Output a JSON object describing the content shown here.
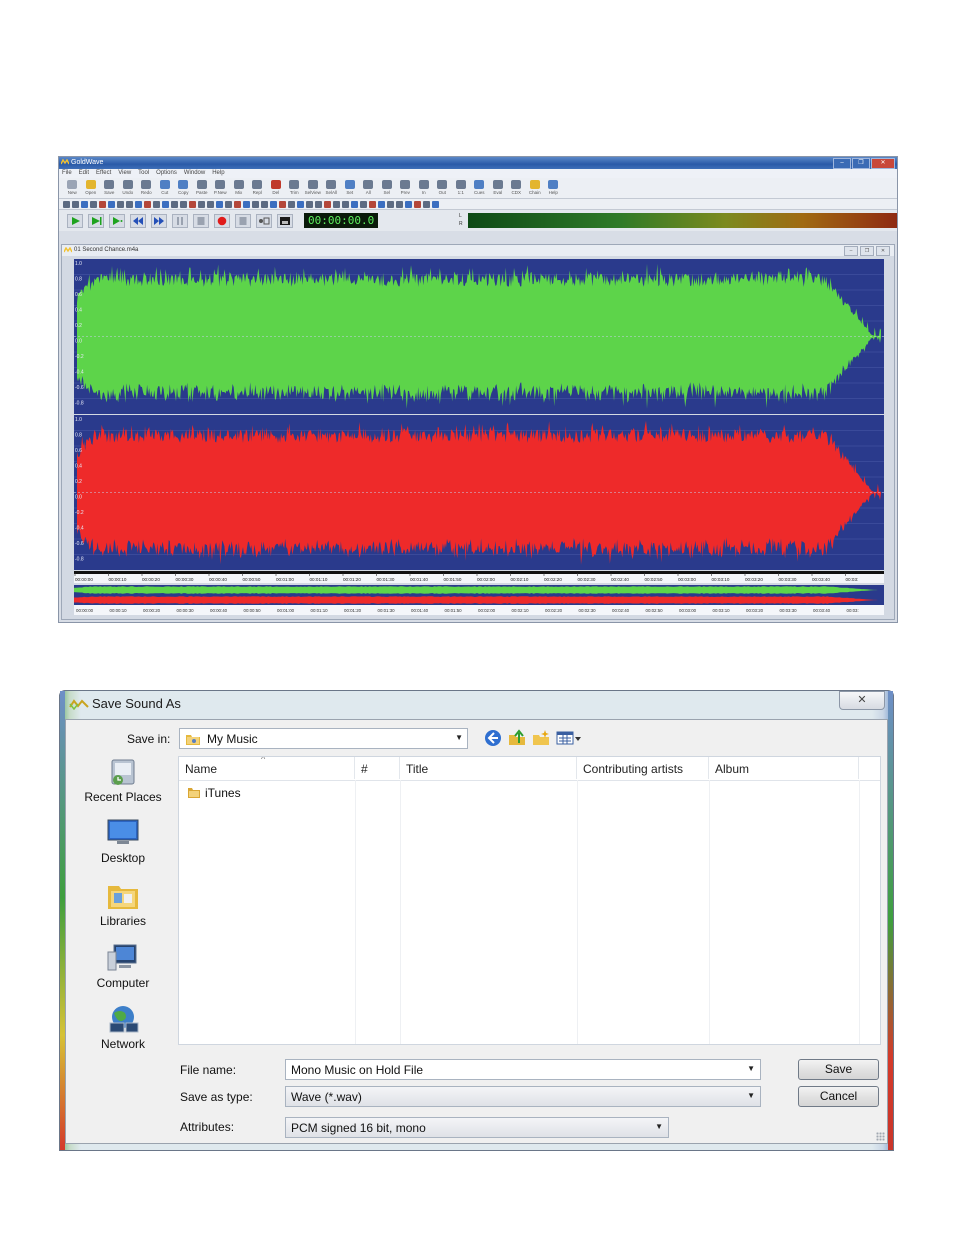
{
  "goldwave": {
    "title": "GoldWave",
    "window_buttons": [
      "–",
      "❐",
      "✕"
    ],
    "menu": [
      "File",
      "Edit",
      "Effect",
      "View",
      "Tool",
      "Options",
      "Window",
      "Help"
    ],
    "toolbar1": [
      {
        "label": "New",
        "icon": "new-file-icon",
        "tone": "p"
      },
      {
        "label": "Open",
        "icon": "open-folder-icon",
        "tone": "y"
      },
      {
        "label": "Save",
        "icon": "save-icon",
        "tone": "g"
      },
      {
        "label": "Undo",
        "icon": "undo-icon",
        "tone": "g"
      },
      {
        "label": "Redo",
        "icon": "redo-icon",
        "tone": "g"
      },
      {
        "label": "Cut",
        "icon": "cut-icon",
        "tone": "a"
      },
      {
        "label": "Copy",
        "icon": "copy-icon",
        "tone": "a"
      },
      {
        "label": "Paste",
        "icon": "paste-icon",
        "tone": "g"
      },
      {
        "label": "P.New",
        "icon": "paste-new-icon",
        "tone": "g"
      },
      {
        "label": "Mix",
        "icon": "mix-icon",
        "tone": "g"
      },
      {
        "label": "Repl",
        "icon": "replace-icon",
        "tone": "g"
      },
      {
        "label": "Del",
        "icon": "delete-icon",
        "tone": "r"
      },
      {
        "label": "Trim",
        "icon": "trim-icon",
        "tone": "g"
      },
      {
        "label": "SelView",
        "icon": "select-view-icon",
        "tone": "g"
      },
      {
        "label": "SelAll",
        "icon": "select-all-icon",
        "tone": "g"
      },
      {
        "label": "Set",
        "icon": "set-icon",
        "tone": "a"
      },
      {
        "label": "All",
        "icon": "zoom-all-icon",
        "tone": "g"
      },
      {
        "label": "Sel",
        "icon": "zoom-selection-icon",
        "tone": "g"
      },
      {
        "label": "Prev",
        "icon": "zoom-previous-icon",
        "tone": "g"
      },
      {
        "label": "In",
        "icon": "zoom-in-icon",
        "tone": "g"
      },
      {
        "label": "Out",
        "icon": "zoom-out-icon",
        "tone": "g"
      },
      {
        "label": "1:1",
        "icon": "zoom-one-icon",
        "tone": "g"
      },
      {
        "label": "Cues",
        "icon": "cues-icon",
        "tone": "a"
      },
      {
        "label": "Eval",
        "icon": "expression-evaluator-icon",
        "tone": "g"
      },
      {
        "label": "CDX",
        "icon": "cd-extract-icon",
        "tone": "g"
      },
      {
        "label": "Chain",
        "icon": "chain-icon",
        "tone": "y"
      },
      {
        "label": "Help",
        "icon": "help-icon",
        "tone": "a"
      }
    ],
    "time": "00:00:00.0",
    "meter_labels": [
      "L",
      "R"
    ],
    "document": {
      "title": "01 Second Chance.m4a",
      "buttons": [
        "–",
        "❐",
        "✕"
      ],
      "amplitude_labels": [
        "1.0",
        "0.8",
        "0.6",
        "0.4",
        "0.2",
        "0.0",
        "-0.2",
        "-0.4",
        "-0.6",
        "-0.8"
      ],
      "timeline": [
        "00:00:00",
        "00:00:10",
        "00:00:20",
        "00:00:30",
        "00:00:40",
        "00:00:50",
        "00:01:00",
        "00:01:10",
        "00:01:20",
        "00:01:30",
        "00:01:40",
        "00:01:50",
        "00:02:00",
        "00:02:10",
        "00:02:20",
        "00:02:30",
        "00:02:40",
        "00:02:50",
        "00:03:00",
        "00:03:10",
        "00:03:20",
        "00:03:30",
        "00:03:40",
        "00:03:"
      ],
      "overview_timeline": [
        "00:00:00",
        "00:00:10",
        "00:00:20",
        "00:00:30",
        "00:00:40",
        "00:00:50",
        "00:01:00",
        "00:01:10",
        "00:01:20",
        "00:01:30",
        "00:01:40",
        "00:01:50",
        "00:02:00",
        "00:02:10",
        "00:02:20",
        "00:02:30",
        "00:02:40",
        "00:02:50",
        "00:03:00",
        "00:03:10",
        "00:03:20",
        "00:03:30",
        "00:03:40",
        "00:03:"
      ]
    },
    "colors": {
      "left_channel": "#5dd44a",
      "right_channel": "#ee2a2a",
      "background": "#2a3a8c"
    }
  },
  "dialog": {
    "title": "Save Sound As",
    "close": "✕",
    "save_in_label": "Save in:",
    "save_in_value": "My Music",
    "columns": [
      "Name",
      "#",
      "Title",
      "Contributing artists",
      "Album"
    ],
    "files": [
      {
        "name": "iTunes",
        "icon": "folder-icon"
      }
    ],
    "places": [
      {
        "label": "Recent Places",
        "icon": "recent-places-icon"
      },
      {
        "label": "Desktop",
        "icon": "desktop-icon"
      },
      {
        "label": "Libraries",
        "icon": "libraries-icon"
      },
      {
        "label": "Computer",
        "icon": "computer-icon"
      },
      {
        "label": "Network",
        "icon": "network-icon"
      }
    ],
    "file_name_label": "File name:",
    "file_name_value": "Mono Music on Hold File",
    "save_type_label": "Save as type:",
    "save_type_value": "Wave (*.wav)",
    "attributes_label": "Attributes:",
    "attributes_value": "PCM signed 16 bit, mono",
    "save_button": "Save",
    "cancel_button": "Cancel"
  }
}
